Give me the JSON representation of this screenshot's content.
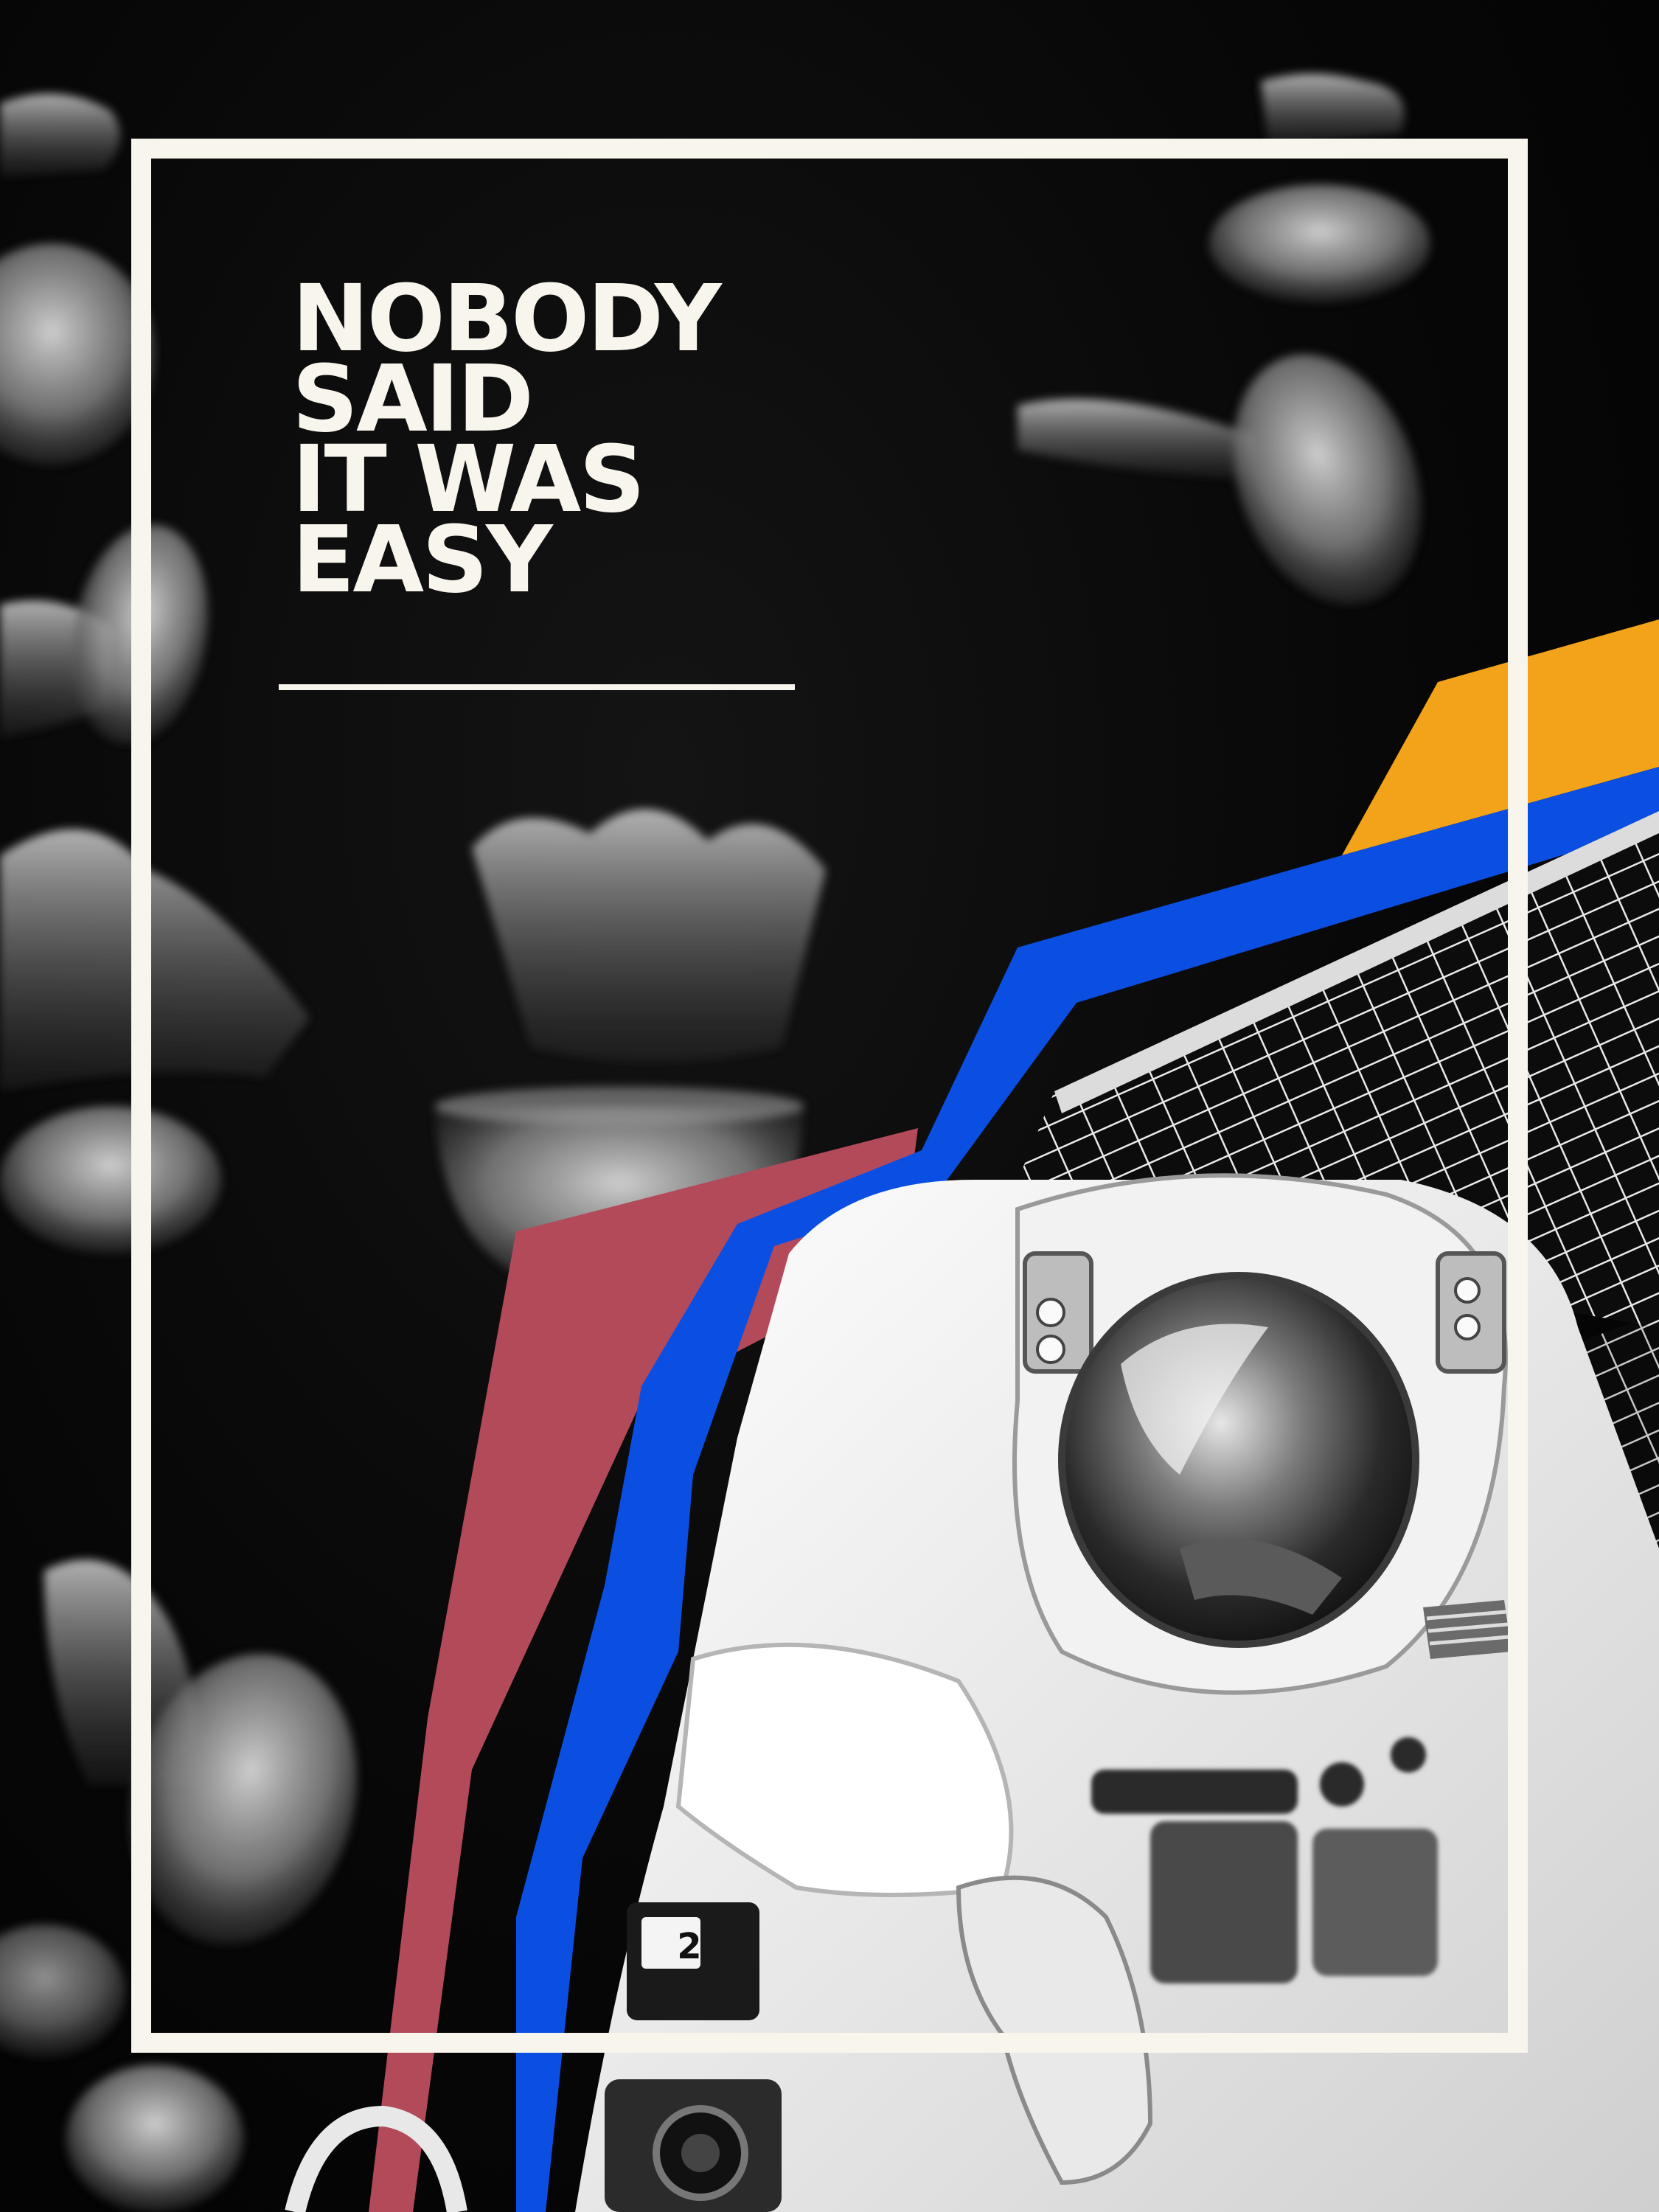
{
  "headline": {
    "lines": [
      "NOBODY",
      "SAID",
      "IT WAS",
      "EASY"
    ]
  },
  "helmet_tag": "2",
  "colors": {
    "background": "#050505",
    "frame": "#f8f5ec",
    "text": "#f8f5ec",
    "orange_stripe": "#f3a31a",
    "blue_stripe": "#0b4fe2",
    "red_stripe": "#b34a5a"
  },
  "imagery": [
    "jellyfish",
    "astronaut",
    "solar-panel"
  ]
}
